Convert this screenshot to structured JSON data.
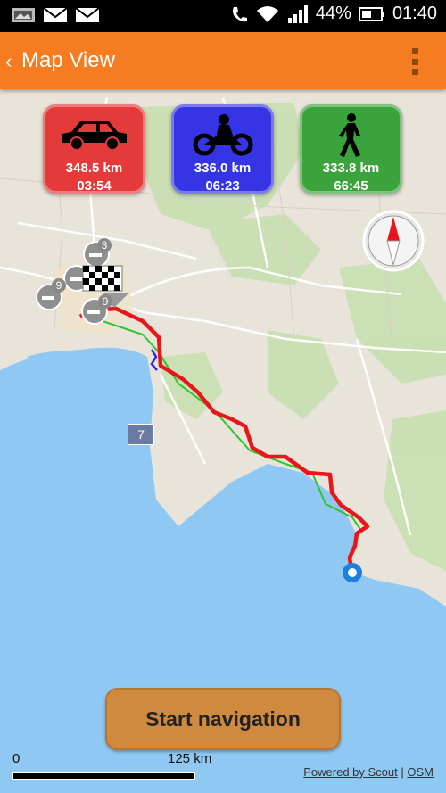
{
  "status_bar": {
    "battery": "44%",
    "time": "01:40"
  },
  "app_bar": {
    "title": "Map View"
  },
  "modes": [
    {
      "name": "car",
      "distance": "348.5 km",
      "time": "03:54",
      "color": "#e53a3a",
      "icon": "car-icon"
    },
    {
      "name": "motorcycle",
      "distance": "336.0 km",
      "time": "06:23",
      "color": "#3535e6",
      "icon": "motorcycle-icon"
    },
    {
      "name": "walk",
      "distance": "333.8 km",
      "time": "66:45",
      "color": "#3ba33b",
      "icon": "walking-icon"
    }
  ],
  "map": {
    "road_badge": "7",
    "poi_badges": [
      "3",
      "9",
      "9"
    ],
    "scale_start": "0",
    "scale_end": "125 km",
    "credit_scout": "Powered by Scout",
    "credit_osm": "OSM",
    "colors": {
      "sea": "#8fc8f2",
      "land": "#e9e4da",
      "forest": "#c8dfb0",
      "route_car": "#e8161b",
      "route_walk": "#2fc52f",
      "route_moto": "#2a2ae0",
      "accent": "#f57c20"
    }
  },
  "actions": {
    "start_navigation": "Start navigation"
  }
}
